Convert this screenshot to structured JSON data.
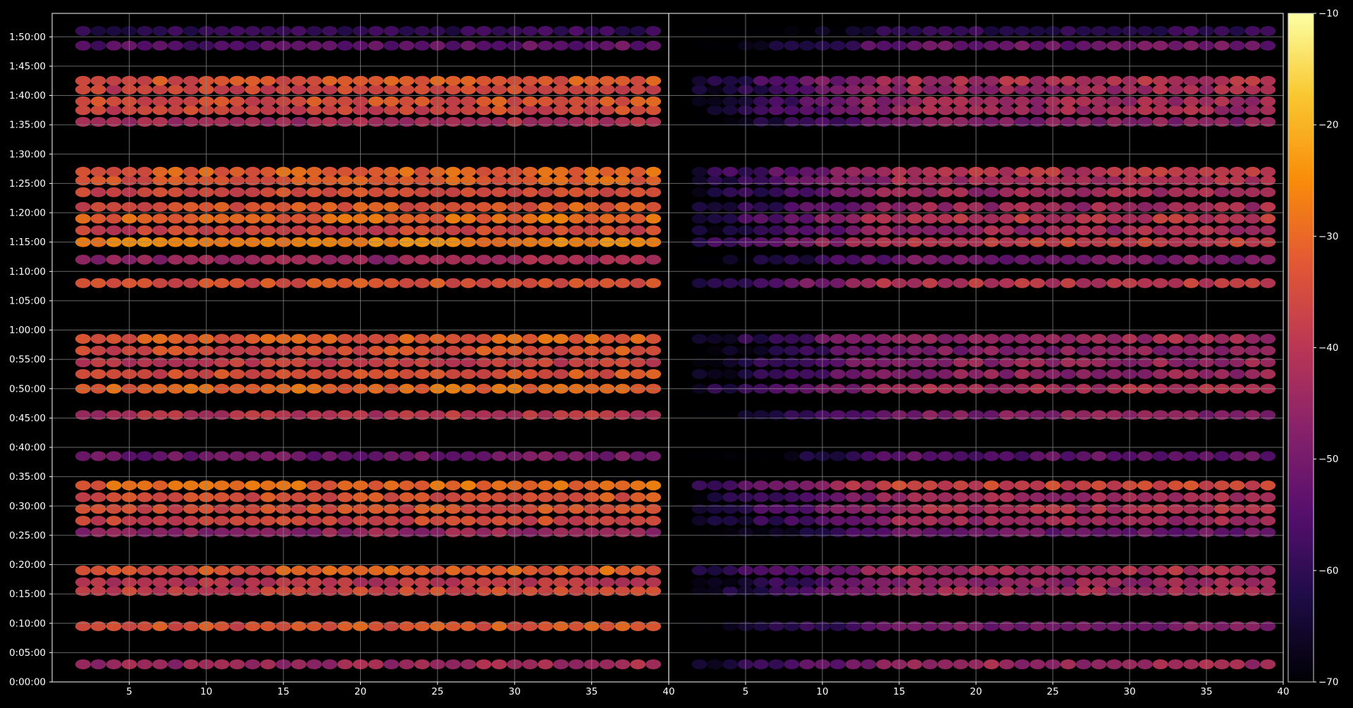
{
  "chart_data": {
    "type": "heatmap",
    "title": "",
    "panels": [
      {
        "name": "",
        "x_ticks": [
          5,
          10,
          15,
          20,
          25,
          30,
          35,
          40
        ],
        "xlim": [
          1,
          40
        ]
      },
      {
        "name": "",
        "x_ticks": [
          5,
          10,
          15,
          20,
          25,
          30,
          35,
          40
        ],
        "xlim": [
          1,
          40
        ]
      }
    ],
    "y_ticks": [
      "0:00:00",
      "0:05:00",
      "0:10:00",
      "0:15:00",
      "0:20:00",
      "0:25:00",
      "0:30:00",
      "0:35:00",
      "0:40:00",
      "0:45:00",
      "0:50:00",
      "0:55:00",
      "1:00:00",
      "1:05:00",
      "1:10:00",
      "1:15:00",
      "1:20:00",
      "1:25:00",
      "1:30:00",
      "1:35:00",
      "1:40:00",
      "1:45:00",
      "1:50:00"
    ],
    "ylim_minutes": [
      0,
      114
    ],
    "colorbar": {
      "colormap": "inferno",
      "range": [
        -70,
        -10
      ],
      "ticks": [
        -10,
        -20,
        -30,
        -40,
        -50,
        -60,
        -70
      ]
    },
    "grid": true,
    "bands": [
      {
        "time_min": 3.0,
        "left": -44,
        "right": -44
      },
      {
        "time_min": 9.5,
        "left": -33,
        "right": -50
      },
      {
        "time_min": 15.5,
        "left": -36,
        "right": -44
      },
      {
        "time_min": 17.0,
        "left": -40,
        "right": -46
      },
      {
        "time_min": 19.0,
        "left": -32,
        "right": -42
      },
      {
        "time_min": 25.5,
        "left": -45,
        "right": -52
      },
      {
        "time_min": 27.5,
        "left": -36,
        "right": -44
      },
      {
        "time_min": 29.5,
        "left": -34,
        "right": -42
      },
      {
        "time_min": 31.5,
        "left": -34,
        "right": -44
      },
      {
        "time_min": 33.5,
        "left": -29,
        "right": -36
      },
      {
        "time_min": 38.5,
        "left": -50,
        "right": -54
      },
      {
        "time_min": 45.5,
        "left": -40,
        "right": -48
      },
      {
        "time_min": 50.0,
        "left": -30,
        "right": -42
      },
      {
        "time_min": 52.5,
        "left": -34,
        "right": -46
      },
      {
        "time_min": 54.5,
        "left": -38,
        "right": -46
      },
      {
        "time_min": 56.5,
        "left": -34,
        "right": -48
      },
      {
        "time_min": 58.5,
        "left": -31,
        "right": -44
      },
      {
        "time_min": 68.0,
        "left": -34,
        "right": -40
      },
      {
        "time_min": 72.0,
        "left": -44,
        "right": -50
      },
      {
        "time_min": 75.0,
        "left": -26,
        "right": -38
      },
      {
        "time_min": 77.0,
        "left": -36,
        "right": -44
      },
      {
        "time_min": 79.0,
        "left": -30,
        "right": -40
      },
      {
        "time_min": 81.0,
        "left": -33,
        "right": -44
      },
      {
        "time_min": 83.5,
        "left": -34,
        "right": -44
      },
      {
        "time_min": 85.5,
        "left": -32,
        "right": -42
      },
      {
        "time_min": 87.0,
        "left": -31,
        "right": -40
      },
      {
        "time_min": 95.5,
        "left": -42,
        "right": -48
      },
      {
        "time_min": 97.5,
        "left": -36,
        "right": -44
      },
      {
        "time_min": 99.0,
        "left": -34,
        "right": -44
      },
      {
        "time_min": 101.0,
        "left": -36,
        "right": -44
      },
      {
        "time_min": 102.5,
        "left": -33,
        "right": -42
      },
      {
        "time_min": 108.5,
        "left": -54,
        "right": -52
      },
      {
        "time_min": 111.0,
        "left": -60,
        "right": -60
      }
    ]
  }
}
